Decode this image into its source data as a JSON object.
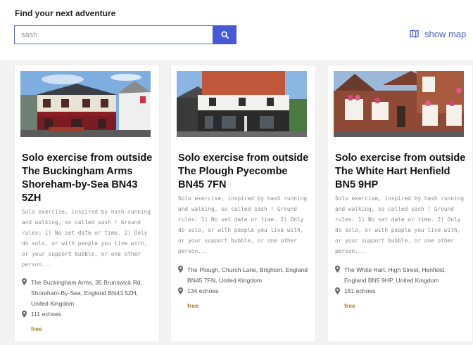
{
  "page": {
    "heading": "Find your next adventure"
  },
  "search": {
    "value": "sash",
    "button_icon": "search-icon"
  },
  "map_link": {
    "label": "show map",
    "icon": "map-icon"
  },
  "colors": {
    "accent": "#4859d8",
    "link": "#4a5fd0",
    "price": "#a88020"
  },
  "cards": [
    {
      "title": "Solo exercise from outside The Buckingham Arms Shoreham-by-Sea BN43 5ZH",
      "description": "Solo exercise, inspired by hash running and walking, so called sash ! Ground rules: 1) No set date or time. 2) Only do solo, or with people you live with, or your support bubble, or one other person...",
      "location": "The Buckingham Arms, 35 Brunswick Rd, Shoreham-By-Sea, England BN43 5ZH, United Kingdom",
      "echoes": "111 echoes",
      "price": "free"
    },
    {
      "title": "Solo exercise from outside The Plough Pyecombe BN45 7FN",
      "description": "Solo exercise, inspired by hash running and walking, so called sash ! Ground rules: 1) No set date or time. 2) Only do solo, or with people you live with, or your support bubble, or one other person...",
      "location": "The Plough, Church Lane, Brighton, England BN45 7FN, United Kingdom",
      "echoes": "134 echoes",
      "price": "free"
    },
    {
      "title": "Solo exercise from outside The White Hart Henfield BN5 9HP",
      "description": "Solo exercise, inspired by hash running and walking, so called sash ! Ground rules: 1) No set date or time. 2) Only do solo, or with people you live with, or your support bubble, or one other person...",
      "location": "The White Hart, High Street, Henfield, England BN5 9HP, United Kingdom",
      "echoes": "161 echoes",
      "price": "free"
    }
  ]
}
